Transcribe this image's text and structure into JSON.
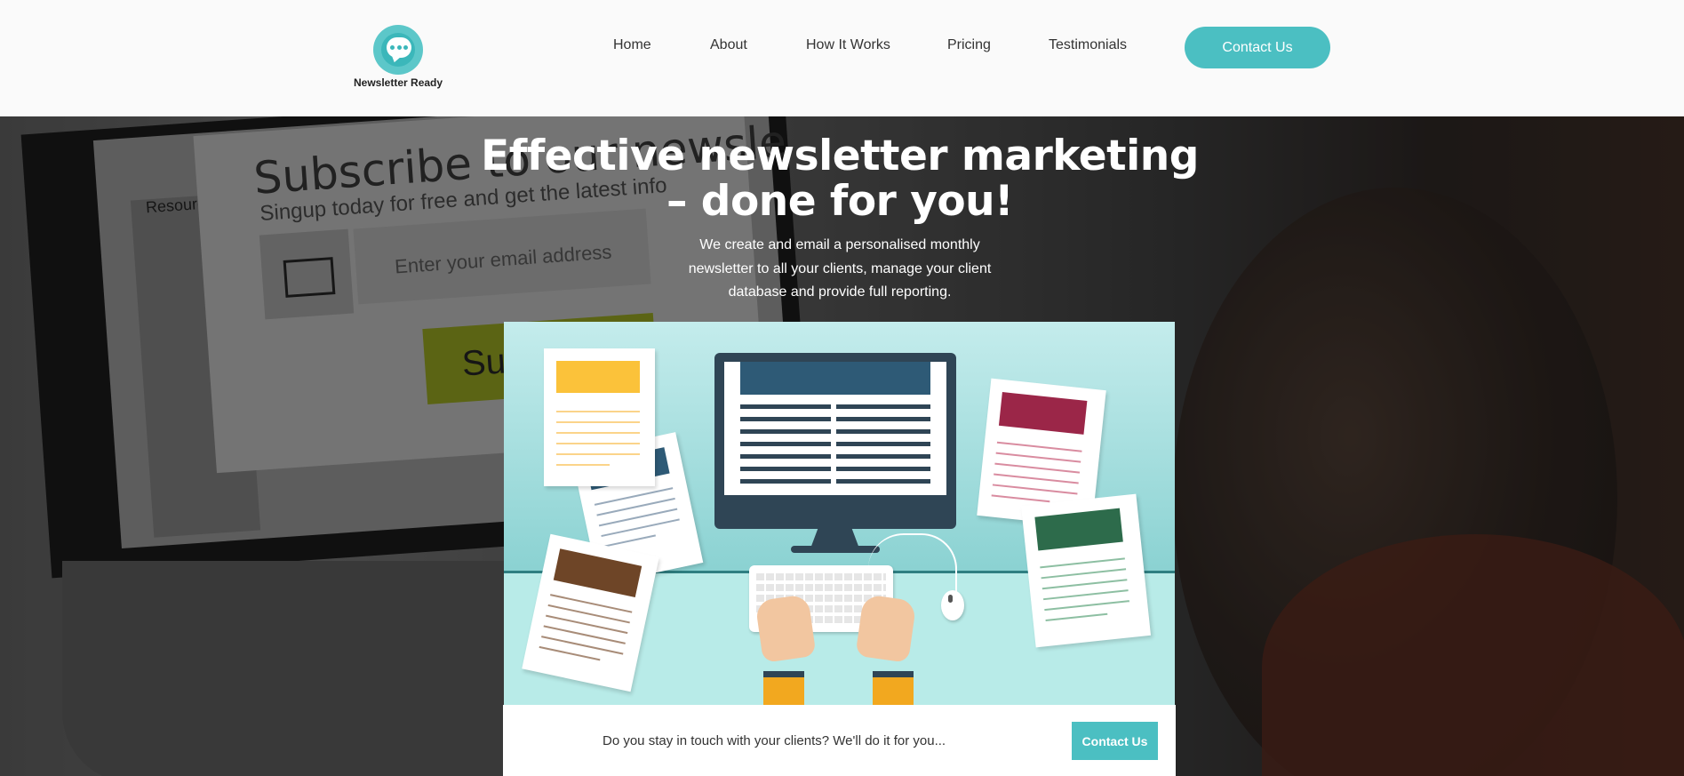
{
  "brand": {
    "name": "Newsletter Ready",
    "accent": "#4bbfc2"
  },
  "nav": {
    "items": [
      {
        "label": "Home"
      },
      {
        "label": "About"
      },
      {
        "label": "How It Works"
      },
      {
        "label": "Pricing"
      },
      {
        "label": "Testimonials"
      }
    ],
    "contact_label": "Contact Us"
  },
  "hero": {
    "title_line1": "Effective newsletter marketing",
    "title_line2": "– done for you!",
    "description": "We create and email a personalised monthly newsletter to all your clients, manage your client database and provide full reporting.",
    "background": {
      "subscribe_text": "Subscribe to our newsle",
      "singup_text": "Singup today for free and get the latest info",
      "email_placeholder": "Enter your email address",
      "button_text": "Su",
      "chart_label": "Resourc"
    }
  },
  "cta": {
    "text": "Do you stay in touch with your clients? We'll do it for you...",
    "button_label": "Contact Us"
  }
}
